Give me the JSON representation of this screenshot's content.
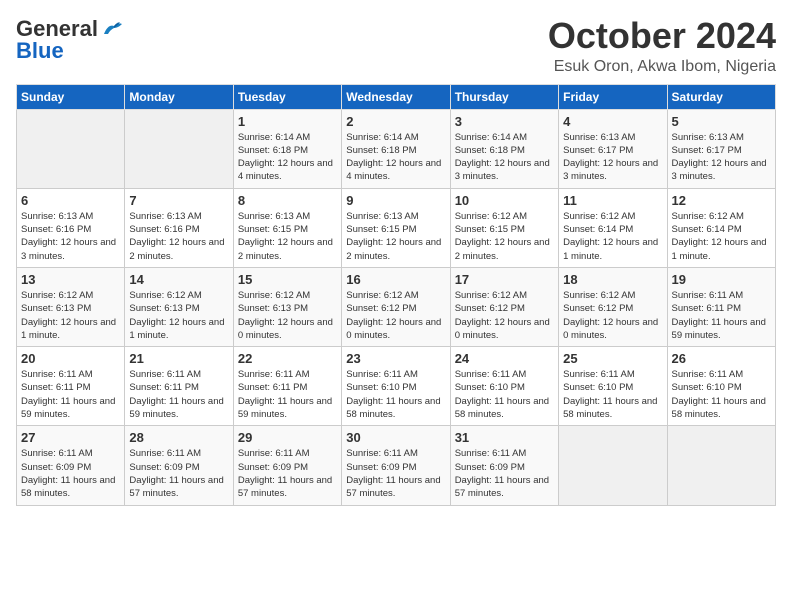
{
  "header": {
    "logo": {
      "line1": "General",
      "line2": "Blue"
    },
    "title": "October 2024",
    "location": "Esuk Oron, Akwa Ibom, Nigeria"
  },
  "weekdays": [
    "Sunday",
    "Monday",
    "Tuesday",
    "Wednesday",
    "Thursday",
    "Friday",
    "Saturday"
  ],
  "weeks": [
    [
      {
        "day": "",
        "sunrise": "",
        "sunset": "",
        "daylight": "",
        "empty": true
      },
      {
        "day": "",
        "sunrise": "",
        "sunset": "",
        "daylight": "",
        "empty": true
      },
      {
        "day": "1",
        "sunrise": "Sunrise: 6:14 AM",
        "sunset": "Sunset: 6:18 PM",
        "daylight": "Daylight: 12 hours and 4 minutes."
      },
      {
        "day": "2",
        "sunrise": "Sunrise: 6:14 AM",
        "sunset": "Sunset: 6:18 PM",
        "daylight": "Daylight: 12 hours and 4 minutes."
      },
      {
        "day": "3",
        "sunrise": "Sunrise: 6:14 AM",
        "sunset": "Sunset: 6:18 PM",
        "daylight": "Daylight: 12 hours and 3 minutes."
      },
      {
        "day": "4",
        "sunrise": "Sunrise: 6:13 AM",
        "sunset": "Sunset: 6:17 PM",
        "daylight": "Daylight: 12 hours and 3 minutes."
      },
      {
        "day": "5",
        "sunrise": "Sunrise: 6:13 AM",
        "sunset": "Sunset: 6:17 PM",
        "daylight": "Daylight: 12 hours and 3 minutes."
      }
    ],
    [
      {
        "day": "6",
        "sunrise": "Sunrise: 6:13 AM",
        "sunset": "Sunset: 6:16 PM",
        "daylight": "Daylight: 12 hours and 3 minutes."
      },
      {
        "day": "7",
        "sunrise": "Sunrise: 6:13 AM",
        "sunset": "Sunset: 6:16 PM",
        "daylight": "Daylight: 12 hours and 2 minutes."
      },
      {
        "day": "8",
        "sunrise": "Sunrise: 6:13 AM",
        "sunset": "Sunset: 6:15 PM",
        "daylight": "Daylight: 12 hours and 2 minutes."
      },
      {
        "day": "9",
        "sunrise": "Sunrise: 6:13 AM",
        "sunset": "Sunset: 6:15 PM",
        "daylight": "Daylight: 12 hours and 2 minutes."
      },
      {
        "day": "10",
        "sunrise": "Sunrise: 6:12 AM",
        "sunset": "Sunset: 6:15 PM",
        "daylight": "Daylight: 12 hours and 2 minutes."
      },
      {
        "day": "11",
        "sunrise": "Sunrise: 6:12 AM",
        "sunset": "Sunset: 6:14 PM",
        "daylight": "Daylight: 12 hours and 1 minute."
      },
      {
        "day": "12",
        "sunrise": "Sunrise: 6:12 AM",
        "sunset": "Sunset: 6:14 PM",
        "daylight": "Daylight: 12 hours and 1 minute."
      }
    ],
    [
      {
        "day": "13",
        "sunrise": "Sunrise: 6:12 AM",
        "sunset": "Sunset: 6:13 PM",
        "daylight": "Daylight: 12 hours and 1 minute."
      },
      {
        "day": "14",
        "sunrise": "Sunrise: 6:12 AM",
        "sunset": "Sunset: 6:13 PM",
        "daylight": "Daylight: 12 hours and 1 minute."
      },
      {
        "day": "15",
        "sunrise": "Sunrise: 6:12 AM",
        "sunset": "Sunset: 6:13 PM",
        "daylight": "Daylight: 12 hours and 0 minutes."
      },
      {
        "day": "16",
        "sunrise": "Sunrise: 6:12 AM",
        "sunset": "Sunset: 6:12 PM",
        "daylight": "Daylight: 12 hours and 0 minutes."
      },
      {
        "day": "17",
        "sunrise": "Sunrise: 6:12 AM",
        "sunset": "Sunset: 6:12 PM",
        "daylight": "Daylight: 12 hours and 0 minutes."
      },
      {
        "day": "18",
        "sunrise": "Sunrise: 6:12 AM",
        "sunset": "Sunset: 6:12 PM",
        "daylight": "Daylight: 12 hours and 0 minutes."
      },
      {
        "day": "19",
        "sunrise": "Sunrise: 6:11 AM",
        "sunset": "Sunset: 6:11 PM",
        "daylight": "Daylight: 11 hours and 59 minutes."
      }
    ],
    [
      {
        "day": "20",
        "sunrise": "Sunrise: 6:11 AM",
        "sunset": "Sunset: 6:11 PM",
        "daylight": "Daylight: 11 hours and 59 minutes."
      },
      {
        "day": "21",
        "sunrise": "Sunrise: 6:11 AM",
        "sunset": "Sunset: 6:11 PM",
        "daylight": "Daylight: 11 hours and 59 minutes."
      },
      {
        "day": "22",
        "sunrise": "Sunrise: 6:11 AM",
        "sunset": "Sunset: 6:11 PM",
        "daylight": "Daylight: 11 hours and 59 minutes."
      },
      {
        "day": "23",
        "sunrise": "Sunrise: 6:11 AM",
        "sunset": "Sunset: 6:10 PM",
        "daylight": "Daylight: 11 hours and 58 minutes."
      },
      {
        "day": "24",
        "sunrise": "Sunrise: 6:11 AM",
        "sunset": "Sunset: 6:10 PM",
        "daylight": "Daylight: 11 hours and 58 minutes."
      },
      {
        "day": "25",
        "sunrise": "Sunrise: 6:11 AM",
        "sunset": "Sunset: 6:10 PM",
        "daylight": "Daylight: 11 hours and 58 minutes."
      },
      {
        "day": "26",
        "sunrise": "Sunrise: 6:11 AM",
        "sunset": "Sunset: 6:10 PM",
        "daylight": "Daylight: 11 hours and 58 minutes."
      }
    ],
    [
      {
        "day": "27",
        "sunrise": "Sunrise: 6:11 AM",
        "sunset": "Sunset: 6:09 PM",
        "daylight": "Daylight: 11 hours and 58 minutes."
      },
      {
        "day": "28",
        "sunrise": "Sunrise: 6:11 AM",
        "sunset": "Sunset: 6:09 PM",
        "daylight": "Daylight: 11 hours and 57 minutes."
      },
      {
        "day": "29",
        "sunrise": "Sunrise: 6:11 AM",
        "sunset": "Sunset: 6:09 PM",
        "daylight": "Daylight: 11 hours and 57 minutes."
      },
      {
        "day": "30",
        "sunrise": "Sunrise: 6:11 AM",
        "sunset": "Sunset: 6:09 PM",
        "daylight": "Daylight: 11 hours and 57 minutes."
      },
      {
        "day": "31",
        "sunrise": "Sunrise: 6:11 AM",
        "sunset": "Sunset: 6:09 PM",
        "daylight": "Daylight: 11 hours and 57 minutes."
      },
      {
        "day": "",
        "sunrise": "",
        "sunset": "",
        "daylight": "",
        "empty": true
      },
      {
        "day": "",
        "sunrise": "",
        "sunset": "",
        "daylight": "",
        "empty": true
      }
    ]
  ]
}
